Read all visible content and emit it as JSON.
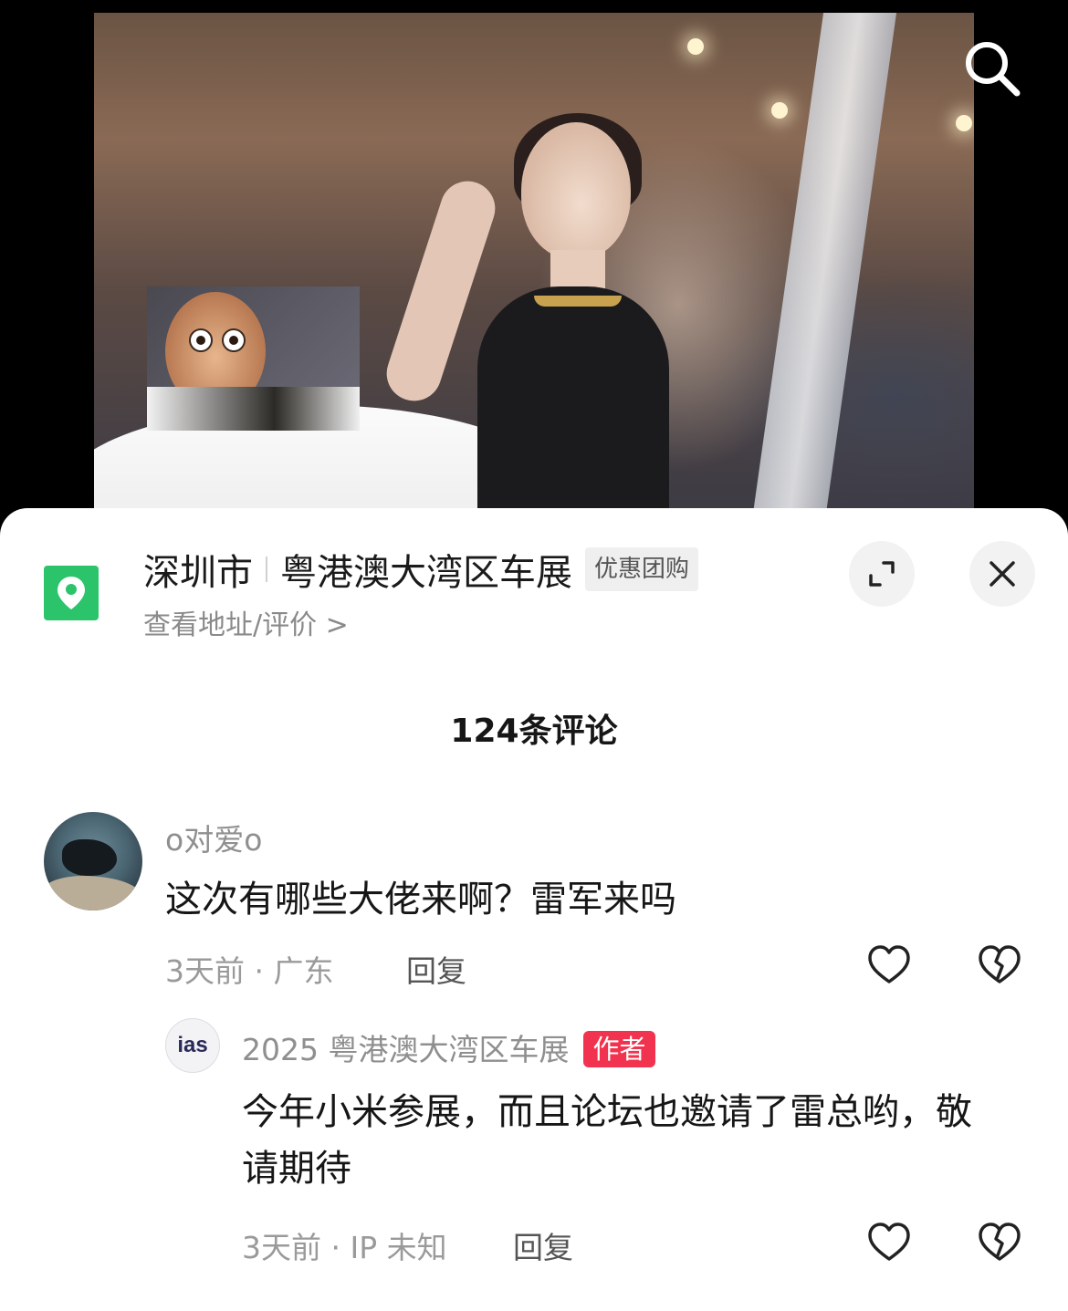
{
  "poi": {
    "city": "深圳市",
    "name": "粤港澳大湾区车展",
    "badge": "优惠团购",
    "subtitle": "查看地址/评价 >"
  },
  "comments_header": {
    "count_label": "124条评论"
  },
  "comments": [
    {
      "username": "o对爱o",
      "text": "这次有哪些大佬来啊？雷军来吗",
      "meta": "3天前 · 广东",
      "reply_label": "回复"
    }
  ],
  "reply": {
    "avatar_text": "ias",
    "username": "2025 粤港澳大湾区车展",
    "author_tag": "作者",
    "text": "今年小米参展，而且论坛也邀请了雷总哟，敬请期待",
    "meta": "3天前 · IP 未知",
    "reply_label": "回复"
  },
  "icons": {
    "search": "search-icon",
    "location": "location-pin-icon",
    "expand": "expand-icon",
    "close": "close-icon",
    "like": "heart-icon",
    "dislike": "broken-heart-icon"
  },
  "colors": {
    "location_green": "#2bc46a",
    "author_tag_red": "#f2334f"
  }
}
